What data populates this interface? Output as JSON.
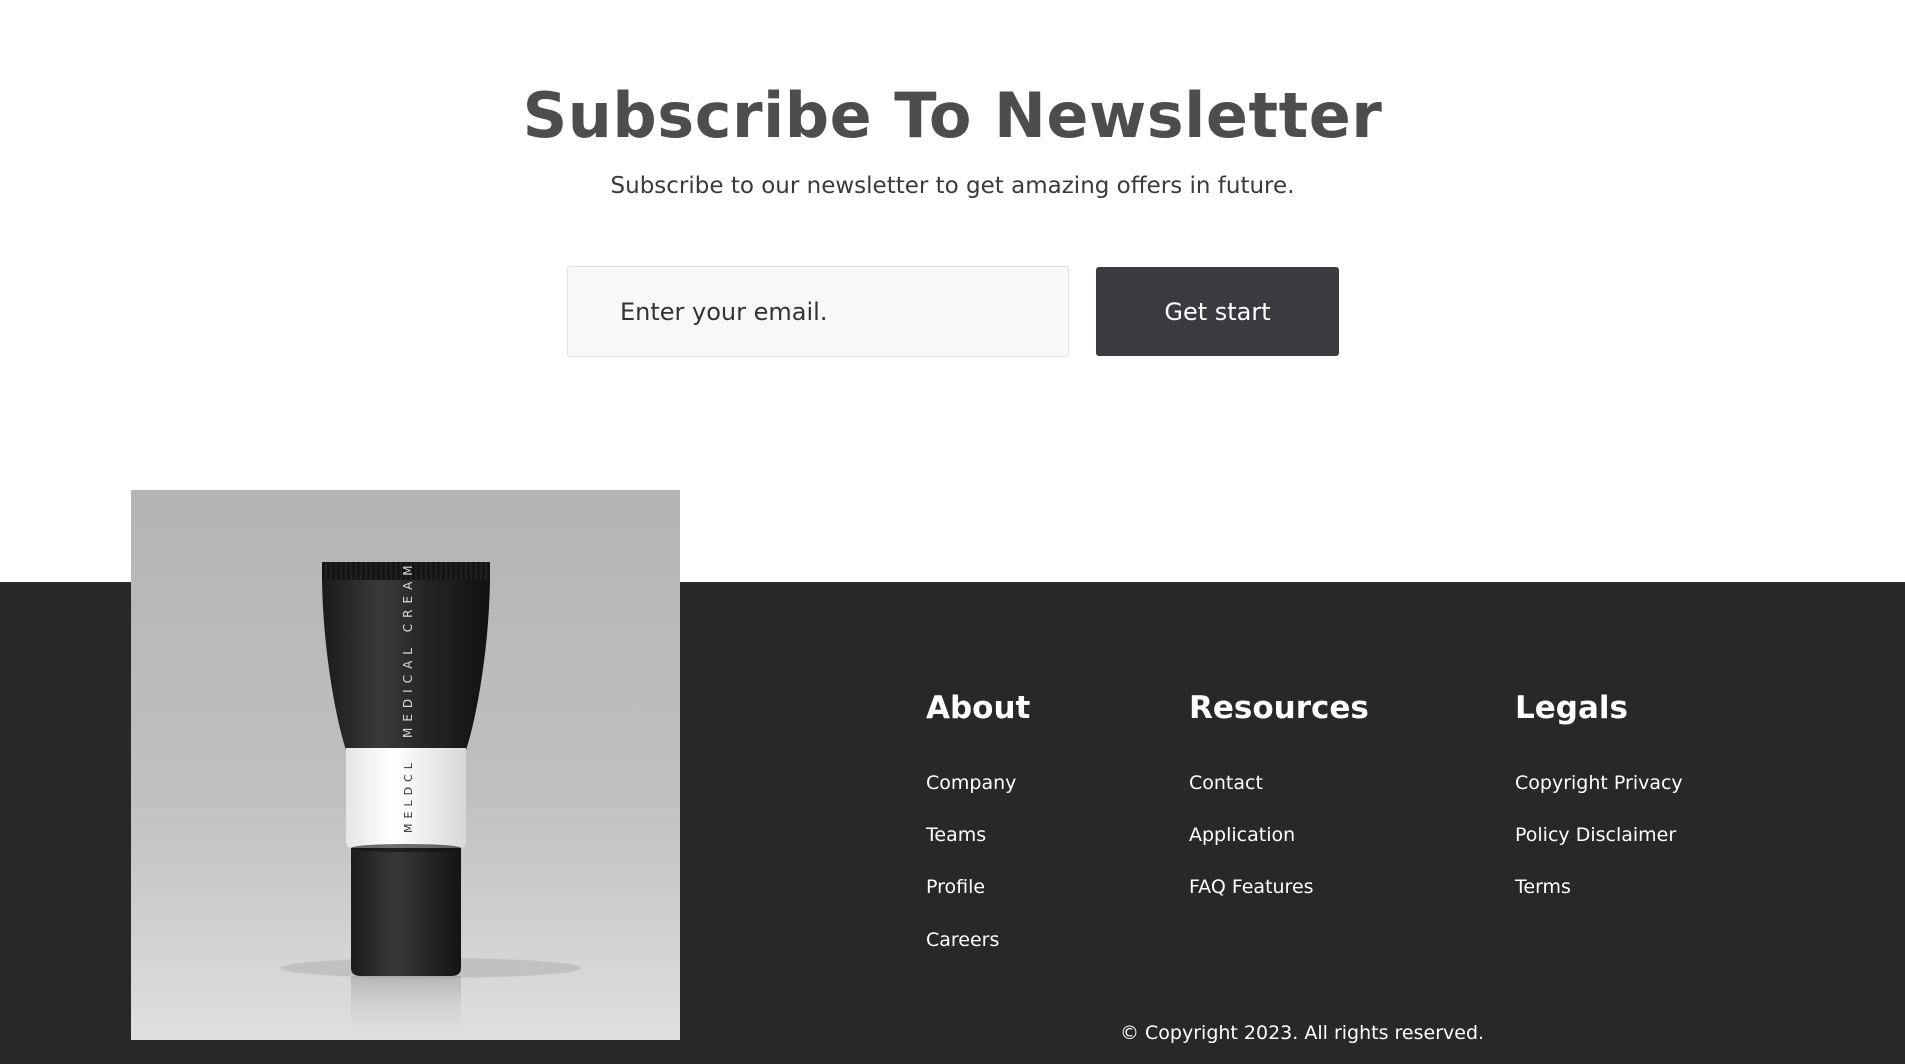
{
  "newsletter": {
    "title": "Subscribe To Newsletter",
    "subtitle": "Subscribe to our newsletter to get amazing offers in future.",
    "email_placeholder": "Enter your email.",
    "button_label": "Get start"
  },
  "product_image": {
    "tube_text_upper": "MEDICAL CREAM",
    "tube_text_lower": "MELDCL",
    "icon": "product-photo-cream-tube"
  },
  "footer": {
    "columns": [
      {
        "heading": "About",
        "links": [
          "Company",
          "Teams",
          "Profile",
          "Careers"
        ]
      },
      {
        "heading": "Resources",
        "links": [
          "Contact",
          "Application",
          "FAQ Features"
        ]
      },
      {
        "heading": "Legals",
        "links": [
          "Copyright Privacy",
          "Policy Disclaimer",
          "Terms"
        ]
      }
    ],
    "copyright": "© Copyright 2023. All rights reserved."
  },
  "colors": {
    "page_background": "#ffffff",
    "footer_background": "#28282a",
    "button_background": "#3a3b40",
    "title_text": "#4d4d4d",
    "input_background": "#f8f8f8"
  }
}
